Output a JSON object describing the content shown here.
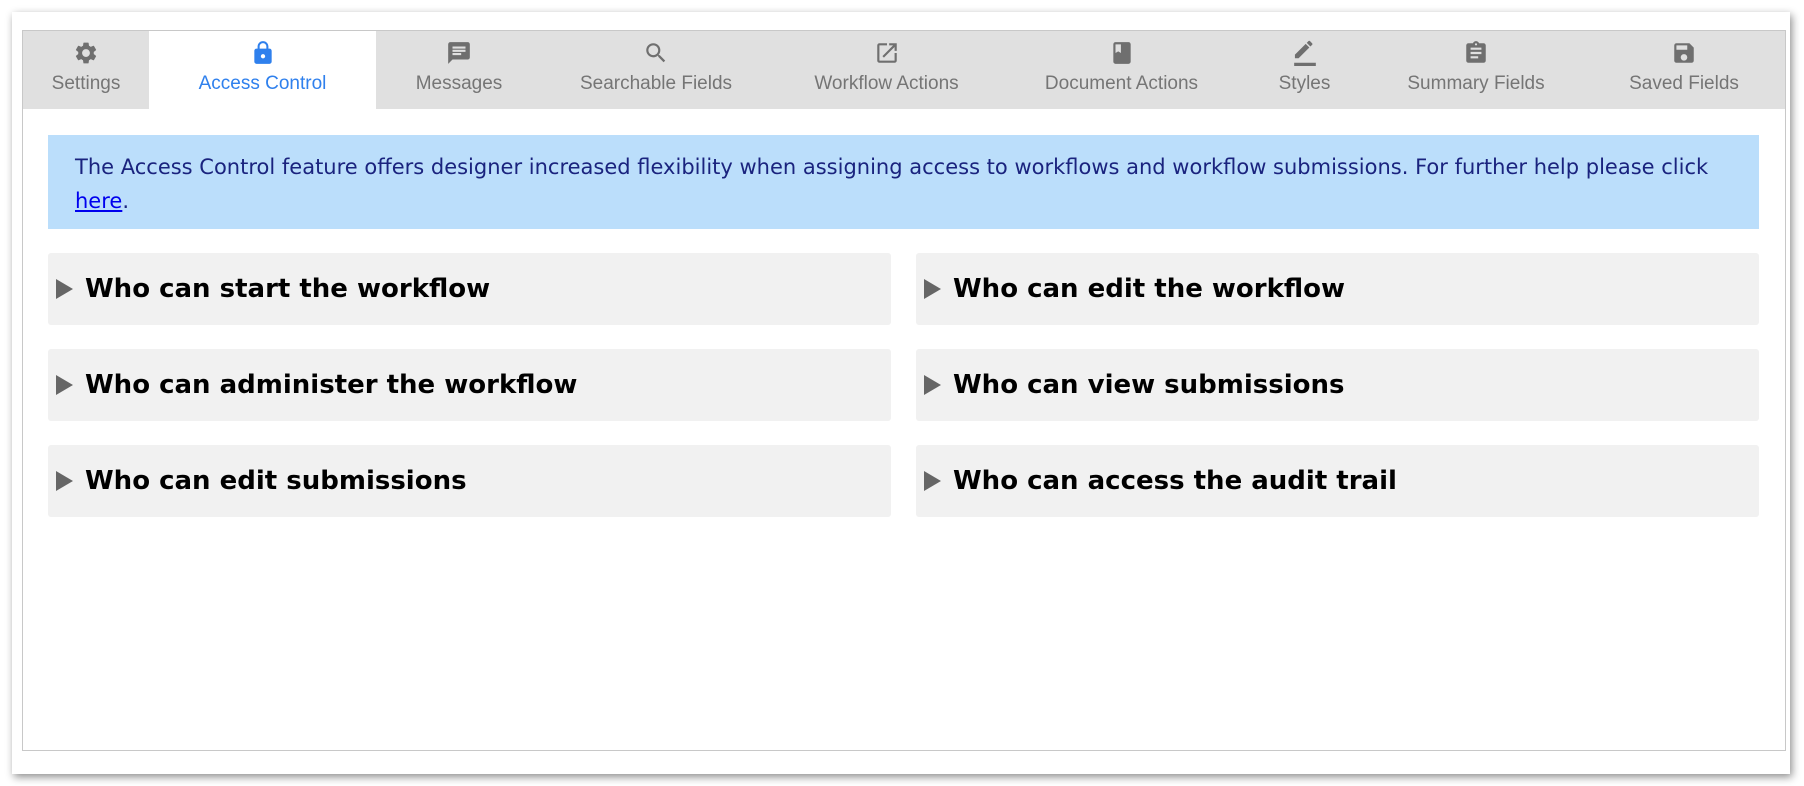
{
  "tabs": [
    {
      "id": "settings",
      "label": "Settings",
      "icon": "gear-icon",
      "active": false
    },
    {
      "id": "access-control",
      "label": "Access Control",
      "icon": "lock-icon",
      "active": true
    },
    {
      "id": "messages",
      "label": "Messages",
      "icon": "message-icon",
      "active": false
    },
    {
      "id": "searchable-fields",
      "label": "Searchable Fields",
      "icon": "search-icon",
      "active": false
    },
    {
      "id": "workflow-actions",
      "label": "Workflow Actions",
      "icon": "open-external-icon",
      "active": false
    },
    {
      "id": "document-actions",
      "label": "Document Actions",
      "icon": "book-icon",
      "active": false
    },
    {
      "id": "styles",
      "label": "Styles",
      "icon": "pencil-icon",
      "active": false
    },
    {
      "id": "summary-fields",
      "label": "Summary Fields",
      "icon": "clipboard-icon",
      "active": false
    },
    {
      "id": "saved-fields",
      "label": "Saved Fields",
      "icon": "floppy-disk-icon",
      "active": false
    }
  ],
  "info": {
    "text": "The Access Control feature offers designer increased flexibility when assigning access to workflows and workflow submissions. For further help please click ",
    "link_text": "here",
    "suffix": "."
  },
  "sections": [
    {
      "label": "Who can start the workflow"
    },
    {
      "label": "Who can edit the workflow"
    },
    {
      "label": "Who can administer the workflow"
    },
    {
      "label": "Who can view submissions"
    },
    {
      "label": "Who can edit submissions"
    },
    {
      "label": "Who can access the audit trail"
    }
  ],
  "colors": {
    "active_tab": "#2f80ed",
    "tab_bar": "#e0e0e0",
    "info_bg": "#bbdefb",
    "info_text": "#1a237e",
    "section_bg": "#f1f1f1"
  }
}
